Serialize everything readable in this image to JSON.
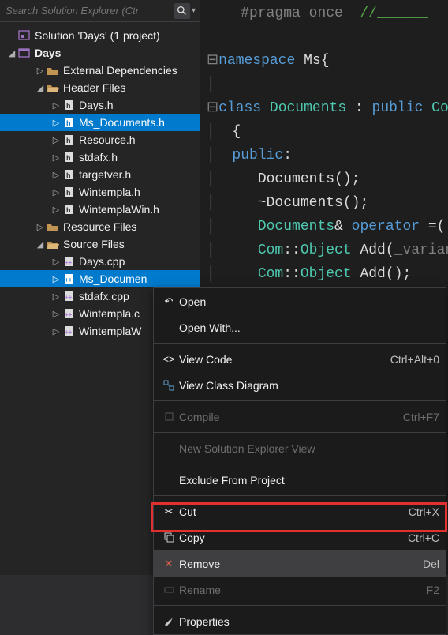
{
  "search": {
    "placeholder": "Search Solution Explorer (Ctr"
  },
  "solution": {
    "label": "Solution 'Days' (1 project)"
  },
  "project": {
    "label": "Days"
  },
  "externaldeps": {
    "label": "External Dependencies"
  },
  "headerfiles": {
    "label": "Header Files"
  },
  "headers": {
    "0": "Days.h",
    "1": "Ms_Documents.h",
    "2": "Resource.h",
    "3": "stdafx.h",
    "4": "targetver.h",
    "5": "Wintempla.h",
    "6": "WintemplaWin.h"
  },
  "resourcefiles": {
    "label": "Resource Files"
  },
  "sourcefiles": {
    "label": "Source Files"
  },
  "sources": {
    "0": "Days.cpp",
    "1": "Ms_Documen",
    "2": "stdafx.cpp",
    "3": "Wintempla.c",
    "4": "WintemplaW"
  },
  "code": {
    "l0_a": "#pragma",
    "l0_b": " once  ",
    "l0_c": "//______",
    "l1_a": "namespace ",
    "l1_b": "Ms",
    "l1_c": "{",
    "l2_a": "class ",
    "l2_b": "Documents",
    "l2_c": " : ",
    "l2_d": "public ",
    "l2_e": "Co",
    "l3": "{",
    "l4_a": "public",
    "l4_b": ":",
    "l5": "Documents();",
    "l6": "~Documents();",
    "l7_a": "Documents",
    "l7_b": "& ",
    "l7_c": "operator ",
    "l7_d": "=(",
    "l8_a": "Com",
    "l8_b": "::",
    "l8_c": "Object",
    "l8_d": " Add(",
    "l8_e": "_varian",
    "l9_a": "Com",
    "l9_b": "::",
    "l9_c": "Object",
    "l9_d": " Add();"
  },
  "menu": {
    "open": "Open",
    "openwith": "Open With...",
    "viewcode": "View Code",
    "viewcode_sc": "Ctrl+Alt+0",
    "classdiag": "View Class Diagram",
    "compile": "Compile",
    "compile_sc": "Ctrl+F7",
    "newview": "New Solution Explorer View",
    "exclude": "Exclude From Project",
    "cut": "Cut",
    "cut_sc": "Ctrl+X",
    "copy": "Copy",
    "copy_sc": "Ctrl+C",
    "remove": "Remove",
    "remove_sc": "Del",
    "rename": "Rename",
    "rename_sc": "F2",
    "properties": "Properties"
  }
}
